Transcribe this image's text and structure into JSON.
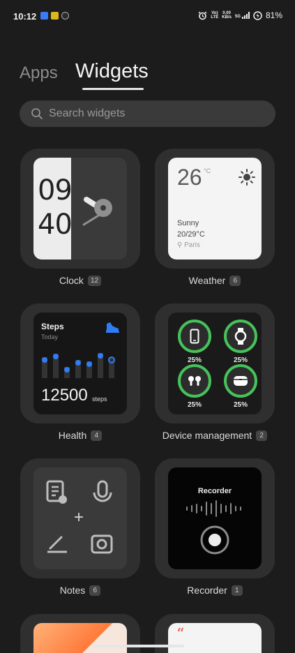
{
  "status_bar": {
    "time": "10:12",
    "network_tag": "Vo) LTE",
    "speed": "0.00",
    "speed_unit": "KB/s",
    "network_type": "5G",
    "battery": "81%"
  },
  "tabs": [
    {
      "label": "Apps",
      "active": false
    },
    {
      "label": "Widgets",
      "active": true
    }
  ],
  "search": {
    "placeholder": "Search widgets"
  },
  "widgets": [
    {
      "name": "Clock",
      "count": "12",
      "preview": {
        "hour": "09",
        "minute": "40"
      }
    },
    {
      "name": "Weather",
      "count": "6",
      "preview": {
        "temp": "26",
        "unit": "°C",
        "condition": "Sunny",
        "range": "20/29°C",
        "city": "Paris"
      }
    },
    {
      "name": "Health",
      "count": "4",
      "preview": {
        "title": "Steps",
        "subtitle": "Today",
        "value": "12500",
        "unit": "steps"
      }
    },
    {
      "name": "Device management",
      "count": "2",
      "preview": {
        "devices": [
          {
            "icon": "phone-icon",
            "level": "25%"
          },
          {
            "icon": "watch-icon",
            "level": "25%"
          },
          {
            "icon": "earbuds-icon",
            "level": "25%"
          },
          {
            "icon": "earbuds-case-icon",
            "level": "25%"
          }
        ]
      }
    },
    {
      "name": "Notes",
      "count": "6"
    },
    {
      "name": "Recorder",
      "count": "1",
      "preview": {
        "title": "Recorder"
      }
    }
  ],
  "colors": {
    "background": "#1c1c1c",
    "card": "#2f2f2f",
    "accent_blue": "#2f7df6",
    "battery_green": "#46c25a"
  }
}
